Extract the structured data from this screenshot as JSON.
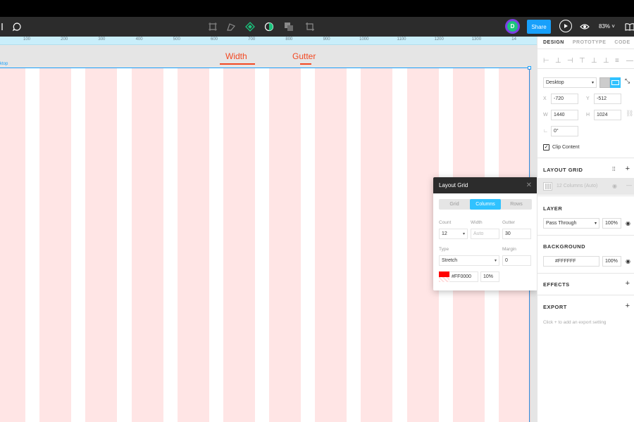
{
  "toolbar": {
    "avatar_initial": "D",
    "share_label": "Share",
    "zoom_label": "83%"
  },
  "ruler": {
    "ticks": [
      "100",
      "200",
      "300",
      "400",
      "500",
      "600",
      "700",
      "800",
      "900",
      "1000",
      "1100",
      "1200",
      "1300",
      "14"
    ]
  },
  "canvas": {
    "width_label": "Width",
    "gutter_label": "Gutter",
    "frame_label": "ktop",
    "grid_color": "#FF0000"
  },
  "layout_grid_popup": {
    "title": "Layout Grid",
    "tabs": [
      "Grid",
      "Columns",
      "Rows"
    ],
    "active_tab": "Columns",
    "count_label": "Count",
    "count_value": "12",
    "width_label": "Width",
    "width_placeholder": "Auto",
    "gutter_label": "Gutter",
    "gutter_value": "30",
    "type_label": "Type",
    "type_value": "Stretch",
    "margin_label": "Margin",
    "margin_value": "0",
    "color_value": "#FF0000",
    "opacity_value": "10%"
  },
  "panel": {
    "tabs": [
      "DESIGN",
      "PROTOTYPE",
      "CODE"
    ],
    "frame_preset": "Desktop",
    "x_label": "X",
    "x_value": "-720",
    "y_label": "Y",
    "y_value": "-512",
    "w_label": "W",
    "w_value": "1440",
    "h_label": "H",
    "h_value": "1024",
    "rotation_value": "0°",
    "clip_content_label": "Clip Content",
    "layout_grid_title": "LAYOUT GRID",
    "layout_grid_item": "12 Columns (Auto)",
    "layer_title": "LAYER",
    "blend_mode": "Pass Through",
    "layer_opacity": "100%",
    "background_title": "BACKGROUND",
    "background_color": "#FFFFFF",
    "background_opacity": "100%",
    "effects_title": "EFFECTS",
    "export_title": "EXPORT",
    "export_hint": "Click + to add an export setting"
  },
  "colors": {
    "accent": "#18a0fb",
    "share": "#18a0fb",
    "segment_active": "#30c2ff",
    "annotation": "#f24822",
    "avatar_ring": "#7b3fe4",
    "avatar_fill": "#1bc47d"
  },
  "icons": [
    "comment-icon",
    "frame-icon",
    "pen-icon",
    "component-icon",
    "mask-icon",
    "boolean-icon",
    "crop-icon",
    "play-icon",
    "eye-icon",
    "library-icon"
  ]
}
